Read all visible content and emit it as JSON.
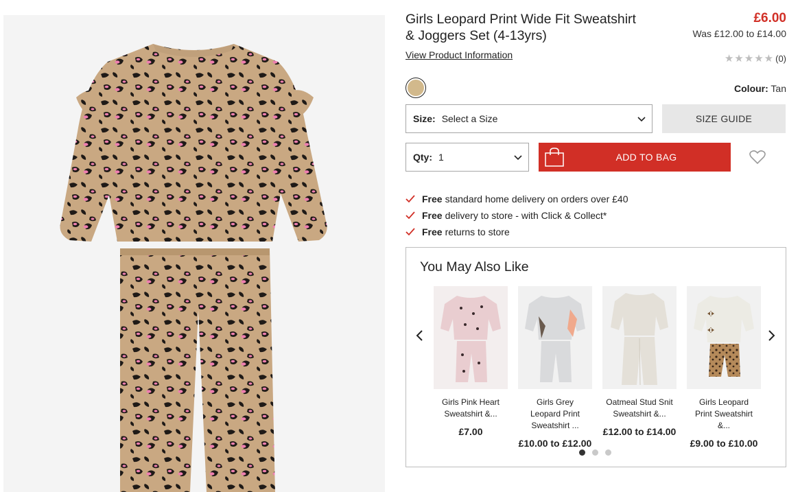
{
  "product": {
    "title": "Girls Leopard Print Wide Fit Sweatshirt & Joggers Set (4-13yrs)",
    "price_now": "£6.00",
    "price_was": "Was £12.00 to £14.00",
    "view_info_link": "View Product Information",
    "rating_count": "(0)",
    "stars": "★★★★★",
    "colour_label": "Colour:",
    "colour_value": "Tan",
    "swatch_color": "#d2b98c",
    "image_icon": "leopard-print-outfit"
  },
  "size": {
    "label": "Size:",
    "value": "Select a Size",
    "guide_button": "SIZE GUIDE"
  },
  "qty": {
    "label": "Qty:",
    "value": "1"
  },
  "bag": {
    "add_label": "ADD TO BAG",
    "icon": "shopping-bag-icon"
  },
  "wishlist": {
    "icon": "heart-icon"
  },
  "benefits": [
    {
      "bold": "Free",
      "text": "standard home delivery on orders over £40"
    },
    {
      "bold": "Free",
      "text": "delivery to store - with Click & Collect*"
    },
    {
      "bold": "Free",
      "text": "returns to store"
    }
  ],
  "also_like": {
    "heading": "You May Also Like",
    "items": [
      {
        "name": "Girls Pink Heart Sweatshirt &...",
        "price": "£7.00"
      },
      {
        "name": "Girls Grey Leopard Print Sweatshirt ...",
        "price": "£10.00 to £12.00"
      },
      {
        "name": "Oatmeal Stud Snit Sweatshirt &...",
        "price": "£12.00 to £14.00"
      },
      {
        "name": "Girls Leopard Print Sweatshirt &...",
        "price": "£9.00 to £10.00"
      }
    ]
  },
  "colors": {
    "accent_red": "#d12f26",
    "star_grey": "#bdbdbd",
    "tick_red": "#d12f26"
  }
}
